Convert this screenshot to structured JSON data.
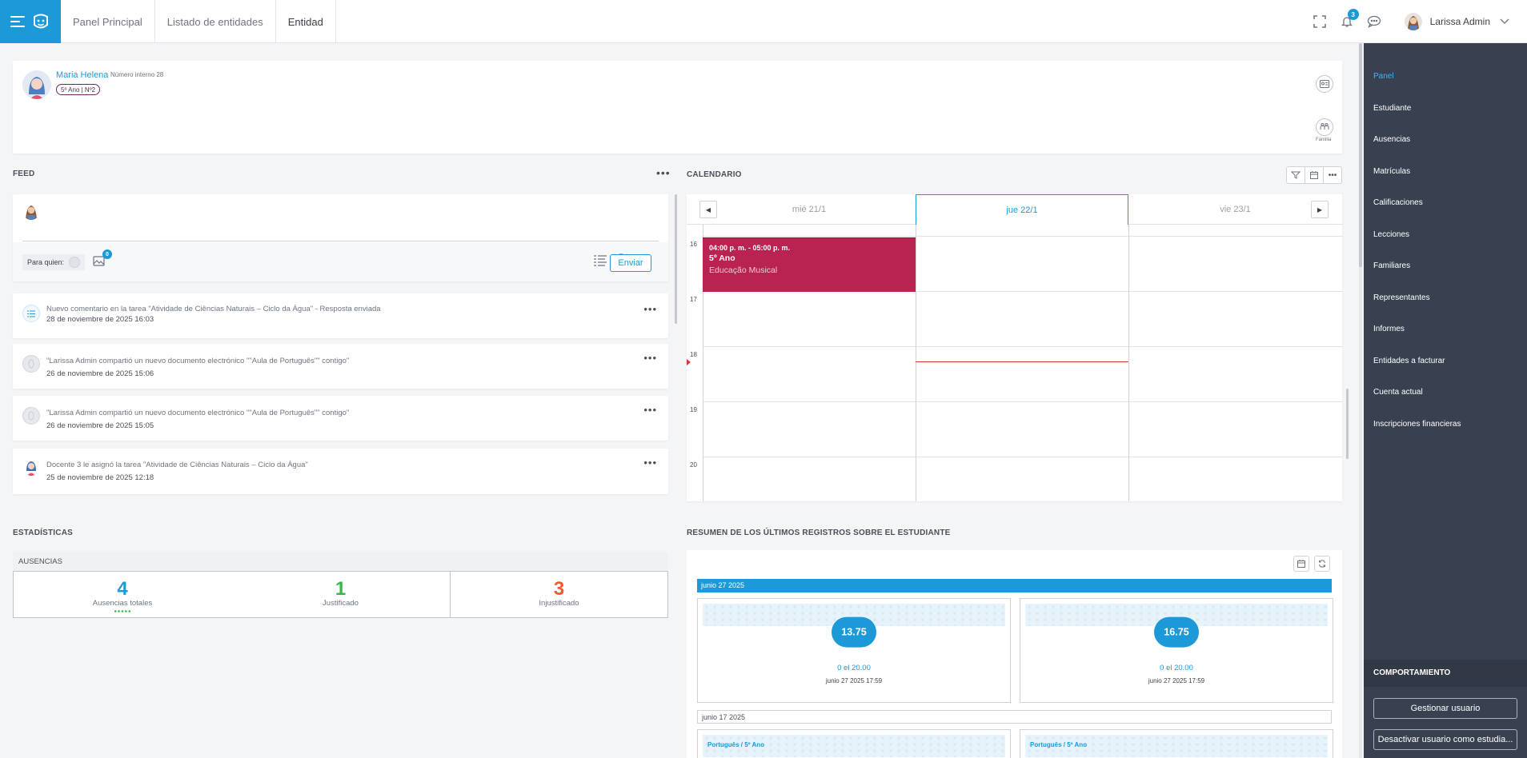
{
  "breadcrumbs": [
    "Panel Principal",
    "Listado de entidades",
    "Entidad"
  ],
  "header": {
    "notifications_count": "3",
    "user_name": "Larissa Admin"
  },
  "student": {
    "name": "Maria Helena",
    "internal_number": "Número interno 28",
    "tag": "5º Ano | Nº2",
    "familia_label": "Familia"
  },
  "sidebar": {
    "items": [
      "Panel",
      "Estudiante",
      "Ausencias",
      "Matrículas",
      "Calificaciones",
      "Lecciones",
      "Familiares",
      "Representantes",
      "Informes",
      "Entidades a facturar",
      "Cuenta actual",
      "Inscripciones financieras"
    ],
    "section": "COMPORTAMIENTO",
    "manage_button": "Gestionar usuario",
    "deactivate_button": "Desactivar usuario como estudia..."
  },
  "feed": {
    "title": "FEED",
    "para_quien": "Para quien:",
    "image_count": "0",
    "send_label": "Enviar",
    "items": [
      {
        "text": "Nuevo comentario en la tarea \"Atividade de Ciências Naturais – Ciclo da Água\" - Resposta enviada",
        "date": "28 de noviembre de 2025 16:03"
      },
      {
        "text": "\"Larissa Admin compartió un nuevo documento electrónico \"\"Aula de Português\"\" contigo\"",
        "date": "26 de noviembre de 2025 15:06"
      },
      {
        "text": "\"Larissa Admin compartió un nuevo documento electrónico \"\"Aula de Português\"\" contigo\"",
        "date": "26 de noviembre de 2025 15:05"
      },
      {
        "text": "Docente 3 le asignó la tarea \"Atividade de Ciências Naturais – Ciclo da Água\"",
        "date": "25 de noviembre de 2025 12:18"
      }
    ]
  },
  "calendar": {
    "title": "CALENDARIO",
    "days": [
      "mié 21/1",
      "jue 22/1",
      "vie 23/1"
    ],
    "hours": [
      "16",
      "17",
      "18",
      "19",
      "20"
    ],
    "event": {
      "time": "04:00 p. m. - 05:00 p. m.",
      "group": "5º Ano",
      "subject": "Educação Musical",
      "color": "#b8234f"
    }
  },
  "stats": {
    "title": "ESTADÍSTICAS",
    "panel": "AUSENCIAS",
    "total": {
      "value": "4",
      "label": "Ausencias totales",
      "color": "#1c9ad8"
    },
    "justified": {
      "value": "1",
      "label": "Justificado",
      "color": "#3bb54a"
    },
    "unjustified": {
      "value": "3",
      "label": "Injustificado",
      "color": "#f05a28"
    }
  },
  "summary": {
    "title": "RESUMEN DE LOS ÚLTIMOS REGISTROS SOBRE EL ESTUDIANTE",
    "date1": "junio 27 2025",
    "grades": [
      {
        "value": "13.75",
        "of": "0 el 20.00",
        "date": "junio 27 2025 17:59"
      },
      {
        "value": "16.75",
        "of": "0 el 20.00",
        "date": "junio 27 2025 17:59"
      }
    ],
    "date2": "junio 17 2025",
    "subjects": [
      "Português / 5º Ano",
      "Português / 5º Ano"
    ]
  },
  "colors": {
    "accent": "#1c9ad8",
    "sidebar": "#394150"
  }
}
